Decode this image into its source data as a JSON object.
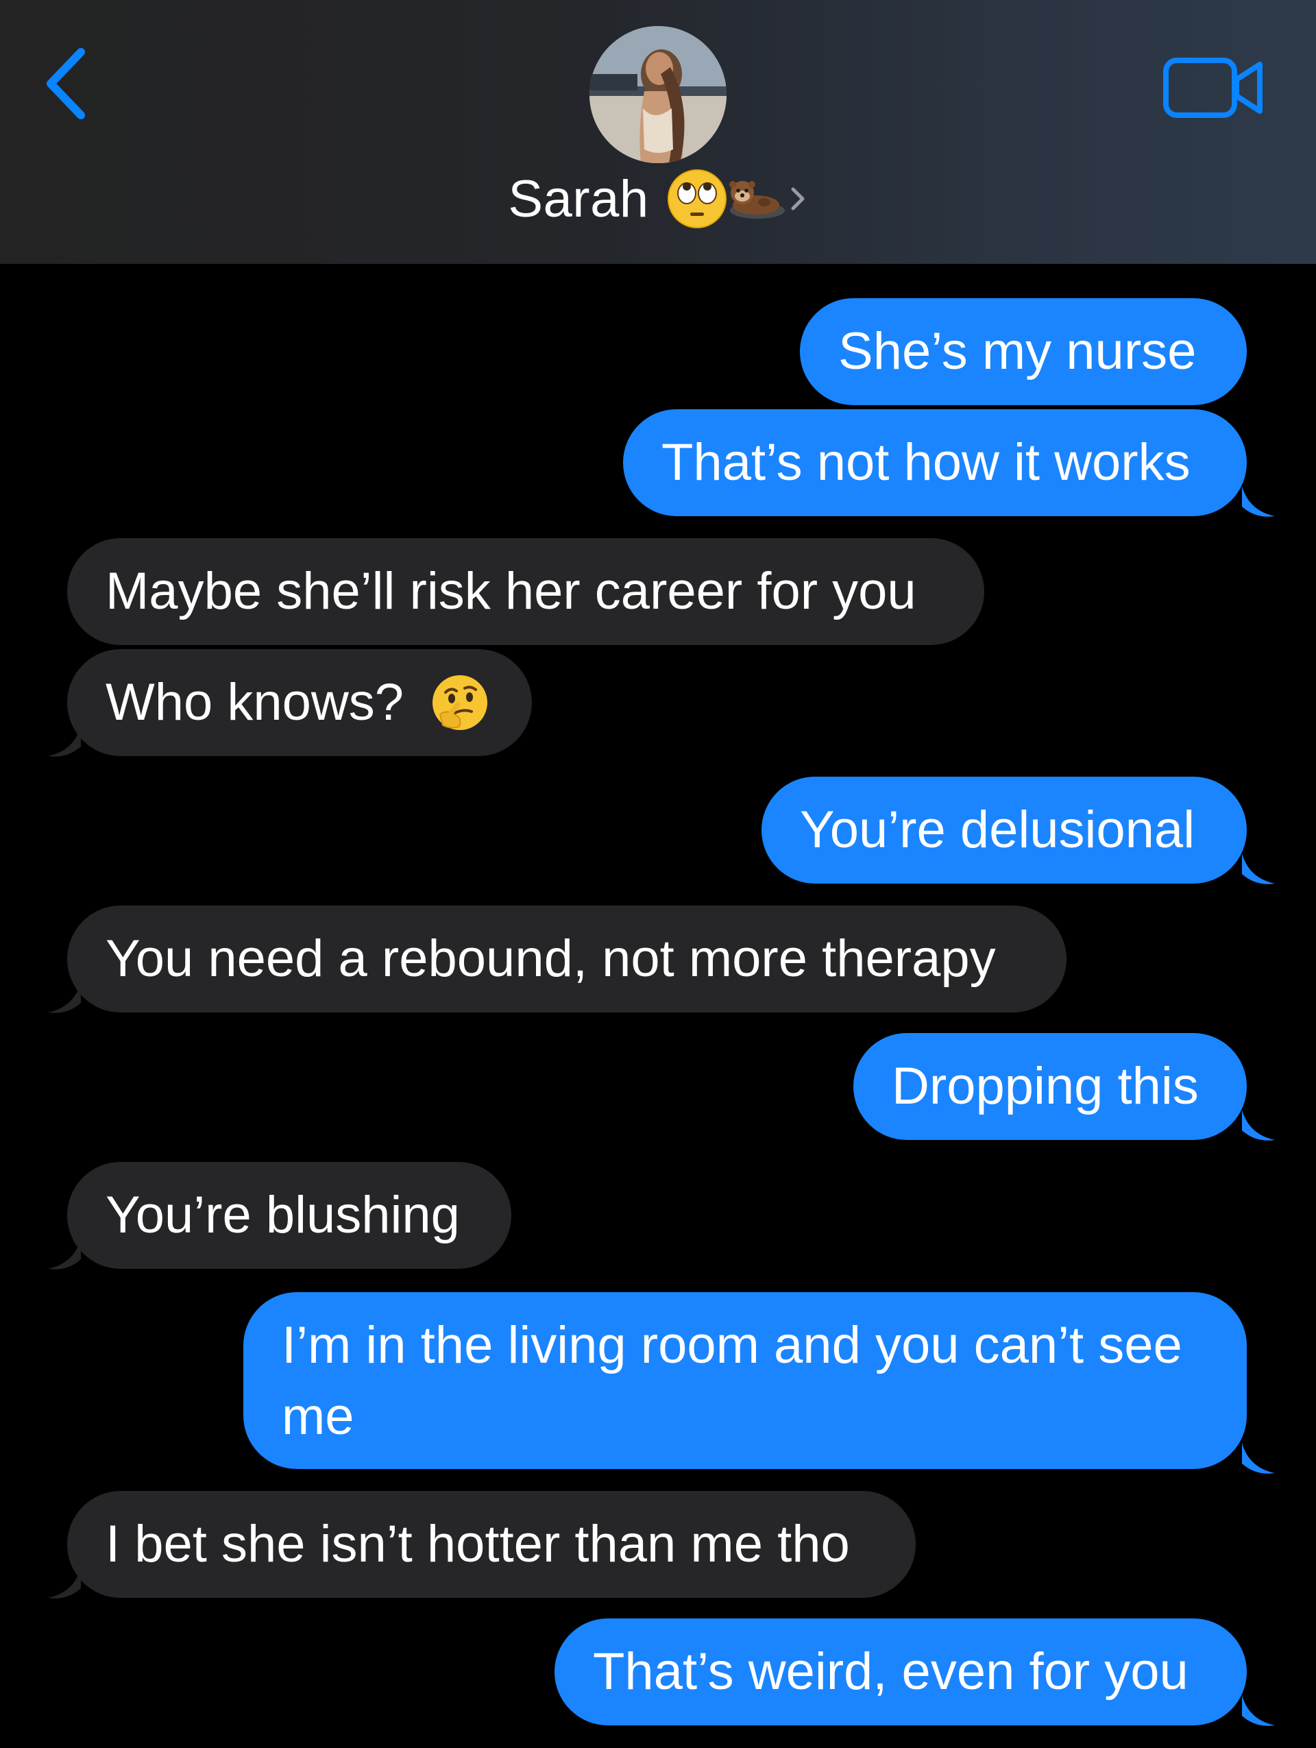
{
  "header": {
    "contact_name": "Sarah",
    "emojis": [
      "face-with-rolling-eyes",
      "otter"
    ]
  },
  "colors": {
    "sent_bubble": "#1a85ff",
    "received_bubble": "#262628",
    "accent": "#0a84ff",
    "background": "#000000"
  },
  "messages": [
    {
      "direction": "sent",
      "text": "She’s my nurse"
    },
    {
      "direction": "sent",
      "text": "That’s not how it works"
    },
    {
      "direction": "received",
      "text": "Maybe she’ll risk her career for you"
    },
    {
      "direction": "received",
      "text": "Who knows?",
      "emoji": "thinking-face"
    },
    {
      "direction": "sent",
      "text": "You’re delusional"
    },
    {
      "direction": "received",
      "text": "You need a rebound, not more therapy"
    },
    {
      "direction": "sent",
      "text": "Dropping this"
    },
    {
      "direction": "received",
      "text": "You’re blushing"
    },
    {
      "direction": "sent",
      "text": "I’m in the living room and you can’t see me"
    },
    {
      "direction": "received",
      "text": "I bet she isn’t hotter than me tho"
    },
    {
      "direction": "sent",
      "text": "That’s weird, even for you"
    }
  ]
}
